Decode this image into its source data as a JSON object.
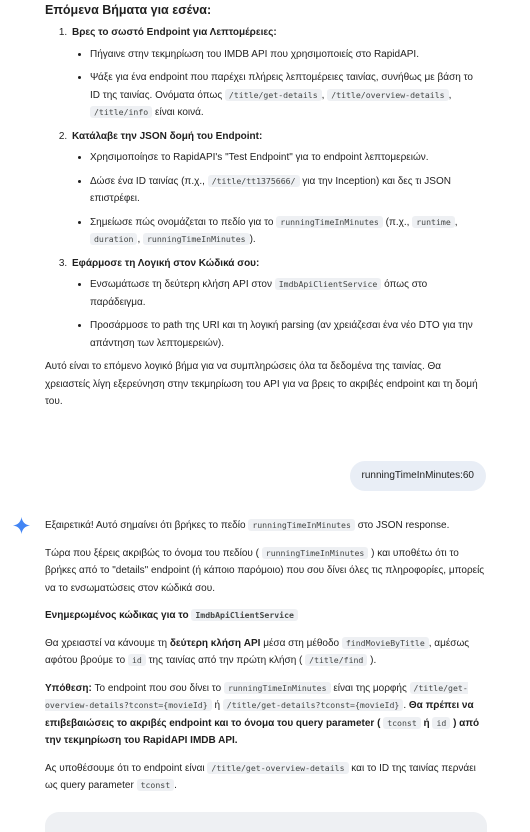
{
  "prev": {
    "heading": "Επόμενα Βήματα για εσένα:",
    "steps": [
      {
        "title": "Βρες το σωστό Endpoint για Λεπτομέρειες:",
        "b1": "Πήγαινε στην τεκμηρίωση του IMDB API που χρησιμοποιείς στο RapidAPI.",
        "b2_text": "Ψάξε για ένα endpoint που παρέχει πλήρεις λεπτομέρειες ταινίας, συνήθως με βάση το ID της ταινίας. Ονόματα όπως",
        "b2_code1": "/title/get-details",
        "b2_sep1": ",",
        "b2_code2": "/title/overview-details",
        "b2_sep2": ",",
        "b2_code3": "/title/info",
        "b2_end": "είναι κοινά."
      },
      {
        "title": "Κατάλαβε την JSON δομή του Endpoint:",
        "b1": "Χρησιμοποίησε το RapidAPI's \"Test Endpoint\" για το endpoint λεπτομερειών.",
        "b2_pre": "Δώσε ένα ID ταινίας (π.χ.,",
        "b2_code": "/title/tt1375666/",
        "b2_post": "για την Inception) και δες τι JSON επιστρέφει.",
        "b3_pre": "Σημείωσε πώς ονομάζεται το πεδίο για το",
        "b3_code1": "runningTimeInMinutes",
        "b3_mid": "(π.χ.,",
        "b3_code2": "runtime",
        "b3_sep1": ",",
        "b3_code3": "duration",
        "b3_sep2": ",",
        "b3_code4": "runningTimeInMinutes",
        "b3_end": ")."
      },
      {
        "title": "Εφάρμοσε τη Λογική στον Κώδικά σου:",
        "b1_pre": "Ενσωμάτωσε τη δεύτερη κλήση API στον",
        "b1_code": "ImdbApiClientService",
        "b1_post": "όπως στο παράδειγμα.",
        "b2": "Προσάρμοσε το path της URI και τη λογική parsing (αν χρειάζεσαι ένα νέο DTO για την απάντηση των λεπτομερειών)."
      }
    ],
    "conclusion": "Αυτό είναι το επόμενο λογικό βήμα για να συμπληρώσεις όλα τα δεδομένα της ταινίας. Θα χρειαστείς λίγη εξερεύνηση στην τεκμηρίωση του API για να βρεις το ακριβές endpoint και τη δομή του."
  },
  "user_message": "runningTimeInMinutes:60",
  "resp": {
    "p1_pre": "Εξαιρετικά! Αυτό σημαίνει ότι βρήκες το πεδίο",
    "p1_code": "runningTimeInMinutes",
    "p1_post": "στο JSON response.",
    "p2_pre": "Τώρα που ξέρεις ακριβώς το όνομα του πεδίου (",
    "p2_code": "runningTimeInMinutes",
    "p2_post": ") και υποθέτω ότι το βρήκες από το \"details\" endpoint (ή κάποιο παρόμοιο) που σου δίνει όλες τις πληροφορίες, μπορείς να το ενσωματώσεις στον κώδικά σου.",
    "h_pre": "Ενημερωμένος κώδικας για το",
    "h_code": "ImdbApiClientService",
    "p3_pre": "Θα χρειαστεί να κάνουμε τη",
    "p3_bold": "δεύτερη κλήση API",
    "p3_mid1": "μέσα στη μέθοδο",
    "p3_code1": "findMovieByTitle",
    "p3_mid2": ", αμέσως αφότου βρούμε το",
    "p3_code2": "id",
    "p3_mid3": "της ταινίας από την πρώτη κλήση (",
    "p3_code3": "/title/find",
    "p3_end": ").",
    "p4_bold1": "Υπόθεση:",
    "p4_t1": "Το endpoint που σου δίνει το",
    "p4_code1": "runningTimeInMinutes",
    "p4_t2": "είναι της μορφής",
    "p4_code2": "/title/get-overview-details?tconst={movieId}",
    "p4_t3": "ή",
    "p4_code3": "/title/get-details?tconst={movieId}",
    "p4_t4": ".",
    "p4_bold2": "Θα πρέπει να επιβεβαιώσεις το ακριβές endpoint και το όνομα του query parameter (",
    "p4_code4": "tconst",
    "p4_t5": "ή",
    "p4_code5": "id",
    "p4_bold3": ") από την τεκμηρίωση του RapidAPI IMDB API.",
    "p5_pre": "Ας υποθέσουμε ότι το endpoint είναι",
    "p5_code1": "/title/get-overview-details",
    "p5_mid": "και το ID της ταινίας περνάει ως query parameter",
    "p5_code2": "tconst",
    "p5_end": "."
  },
  "colors": {
    "spark_blue": "#4285f4",
    "bubble_bg": "#e9eef6",
    "code_bg": "#eef0f3"
  }
}
